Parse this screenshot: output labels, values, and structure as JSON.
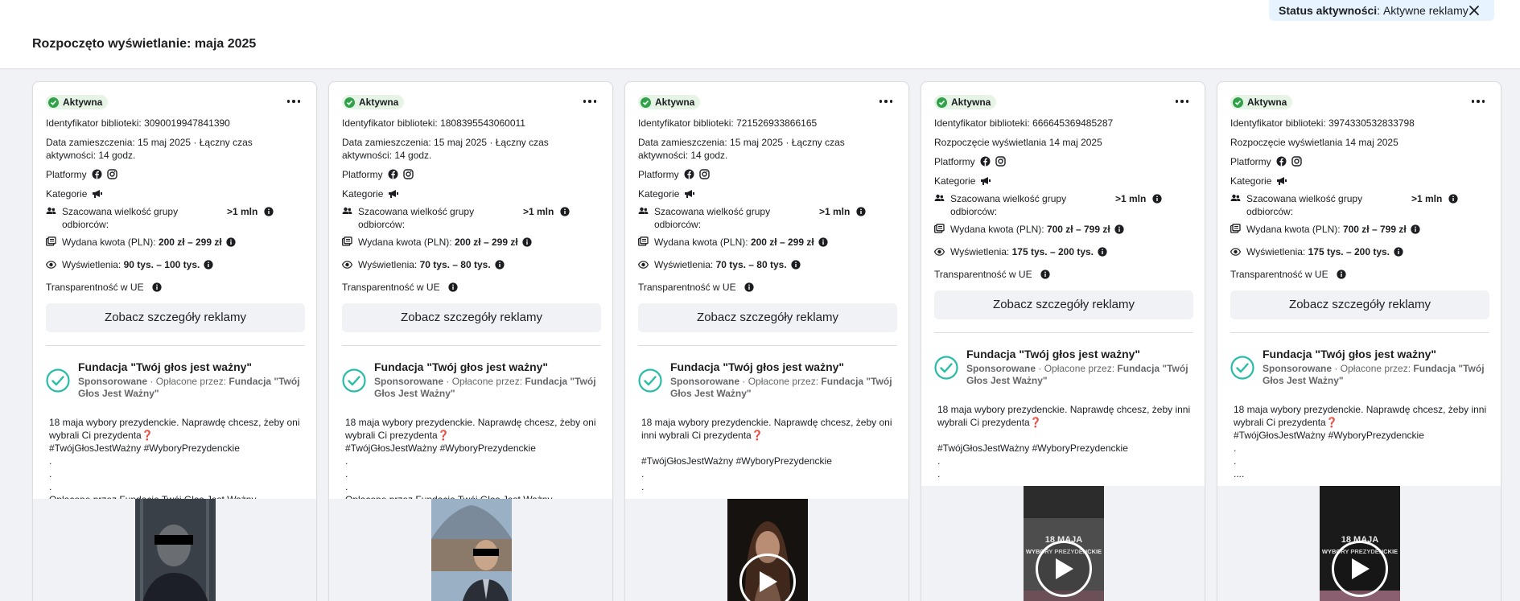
{
  "header": {
    "title": "Rozpoczęto wyświetlanie: maja 2025",
    "filter_key": "Status aktywności",
    "filter_value": "Aktywne reklamy"
  },
  "labels": {
    "status": "Aktywna",
    "platforms": "Platformy",
    "categories": "Kategorie",
    "audience": "Szacowana wielkość grupy odbiorców:",
    "spent": "Wydana kwota (PLN):",
    "views": "Wyświetlenia:",
    "transparency": "Transparentność w UE",
    "details_button": "Zobacz szczegóły reklamy",
    "sponsored": "Sponsorowane",
    "paid_by": "Opłacone przez:"
  },
  "cards": [
    {
      "library_id": "Identyfikator biblioteki: 3090019947841390",
      "date_text": "Data zamieszczenia: 15 maj 2025 · Łączny czas aktywności: 14 godz.",
      "audience": ">1 mln",
      "spent": "200 zł – 299 zł",
      "views": "90 tys. – 100 tys.",
      "advertiser": "Fundacja \"Twój głos jest ważny\"",
      "payer": "Fundacja \"Twój Głos Jest Ważny\"",
      "body": "18 maja wybory prezydenckie. Naprawdę chcesz, żeby oni wybrali Ci prezydenta❓\n#TwójGłosJestWażny #WyboryPrezydenckie\n.\n.\n.\nOpłacone przez Fundację Twój Głos Jest Ważny."
    },
    {
      "library_id": "Identyfikator biblioteki: 1808395543060011",
      "date_text": "Data zamieszczenia: 15 maj 2025 · Łączny czas aktywności: 14 godz.",
      "audience": ">1 mln",
      "spent": "200 zł – 299 zł",
      "views": "70 tys. – 80 tys.",
      "advertiser": "Fundacja \"Twój głos jest ważny\"",
      "payer": "Fundacja \"Twój Głos Jest Ważny\"",
      "body": "18 maja wybory prezydenckie. Naprawdę chcesz, żeby oni wybrali Ci prezydenta❓\n#TwójGłosJestWażny #WyboryPrezydenckie\n.\n.\n.\nOpłacone przez Fundację Twój Głos Jest Ważny."
    },
    {
      "library_id": "Identyfikator biblioteki: 721526933866165",
      "date_text": "Data zamieszczenia: 15 maj 2025 · Łączny czas aktywności: 14 godz.",
      "audience": ">1 mln",
      "spent": "200 zł – 299 zł",
      "views": "70 tys. – 80 tys.",
      "advertiser": "Fundacja \"Twój głos jest ważny\"",
      "payer": "Fundacja \"Twój Głos Jest Ważny\"",
      "body": "18 maja wybory prezydenckie. Naprawdę chcesz, żeby oni inni wybrali Ci prezydenta❓\n\n#TwójGłosJestWażny #WyboryPrezydenckie\n.\n.\n...."
    },
    {
      "library_id": "Identyfikator biblioteki: 666645369485287",
      "date_text": "Rozpoczęcie wyświetlania 14 maj 2025",
      "audience": ">1 mln",
      "spent": "700 zł – 799 zł",
      "views": "175 tys. – 200 tys.",
      "advertiser": "Fundacja \"Twój głos jest ważny\"",
      "payer": "Fundacja \"Twój Głos Jest Ważny\"",
      "body": "18 maja wybory prezydenckie. Naprawdę chcesz, żeby inni wybrali Ci prezydenta❓\n\n#TwójGłosJestWażny #WyboryPrezydenckie\n.\n.\n...."
    },
    {
      "library_id": "Identyfikator biblioteki: 3974330532833798",
      "date_text": "Rozpoczęcie wyświetlania 14 maj 2025",
      "audience": ">1 mln",
      "spent": "700 zł – 799 zł",
      "views": "175 tys. – 200 tys.",
      "advertiser": "Fundacja \"Twój głos jest ważny\"",
      "payer": "Fundacja \"Twój Głos Jest Ważny\"",
      "body": "18 maja wybory prezydenckie. Naprawdę chcesz, żeby inni wybrali Ci prezydenta❓\n#TwójGłosJestWażny #WyboryPrezydenckie\n.\n.\n...."
    }
  ],
  "thumb_texts": {
    "headline": "18 MAJA",
    "subline": "WYBORY PREZYDENCKIE"
  },
  "icons": {
    "status": "check-circle-icon",
    "more": "more-horizontal-icon",
    "facebook": "facebook-icon",
    "instagram": "instagram-icon",
    "category": "megaphone-icon",
    "audience": "people-icon",
    "spent": "money-icon",
    "views": "eye-icon",
    "info": "info-icon",
    "verified": "verified-check-icon",
    "play": "play-icon",
    "close": "close-icon"
  },
  "colors": {
    "active_green": "#31a24c",
    "verified_teal": "#2abba7",
    "chip_bg": "#e7f3ff",
    "button_bg": "#f0f2f5"
  }
}
